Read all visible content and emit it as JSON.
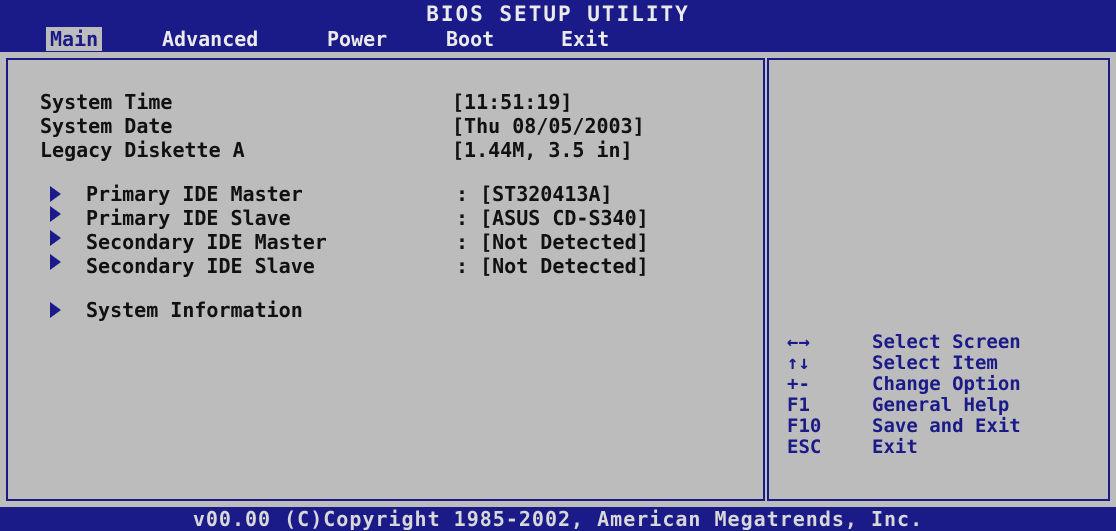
{
  "header": {
    "title": "BIOS SETUP UTILITY",
    "menu": [
      {
        "label": "Main"
      },
      {
        "label": "Advanced"
      },
      {
        "label": "Power"
      },
      {
        "label": "Boot"
      },
      {
        "label": "Exit"
      }
    ]
  },
  "main": {
    "settings": [
      {
        "label": "System Time",
        "value": "[11:51:19]"
      },
      {
        "label": "System Date",
        "value": "[Thu 08/05/2003]"
      },
      {
        "label": "Legacy Diskette A",
        "value": "[1.44M, 3.5 in]"
      }
    ],
    "submenus": [
      {
        "label": "Primary IDE Master",
        "value": ": [ST320413A]"
      },
      {
        "label": "Primary IDE Slave",
        "value": ": [ASUS CD-S340]"
      },
      {
        "label": "Secondary IDE Master",
        "value": ": [Not Detected]"
      },
      {
        "label": "Secondary IDE Slave",
        "value": ": [Not Detected]"
      }
    ],
    "system_information": "System Information"
  },
  "help": {
    "keys": [
      {
        "key": "←→",
        "desc": "Select Screen"
      },
      {
        "key": "↑↓",
        "desc": "Select Item"
      },
      {
        "key": "+-",
        "desc": "Change Option"
      },
      {
        "key": "F1",
        "desc": "General Help"
      },
      {
        "key": "F10",
        "desc": "Save and Exit"
      },
      {
        "key": "ESC",
        "desc": "Exit"
      }
    ]
  },
  "footer": {
    "copyright": "v00.00 (C)Copyright 1985-2002, American Megatrends, Inc."
  },
  "colors": {
    "bar": "#1a1a88",
    "panel": "#bcbcbc"
  }
}
